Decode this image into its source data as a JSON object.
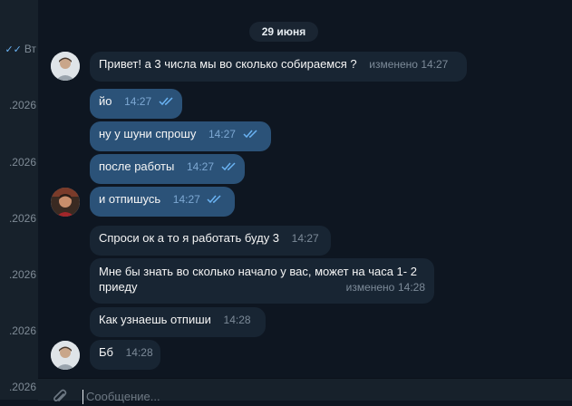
{
  "sidebar": {
    "rows": [
      {
        "day": "Вт",
        "ticks": true
      },
      {
        "date": ".2026"
      },
      {
        "date": ".2026"
      },
      {
        "date": ".2026"
      },
      {
        "date": ".2026"
      },
      {
        "date": ".2026"
      },
      {
        "date": ".2026"
      }
    ]
  },
  "chat": {
    "date_separator": "29 июня",
    "messages": [
      {
        "dir": "in",
        "text": "Привет! а 3 числа мы во сколько собираемся ?",
        "edited": "изменено",
        "time": "14:27"
      },
      {
        "dir": "out",
        "text": "йо",
        "time": "14:27",
        "read": true
      },
      {
        "dir": "out",
        "text": "ну у шуни спрошу",
        "time": "14:27",
        "read": true
      },
      {
        "dir": "out",
        "text": "после работы",
        "time": "14:27",
        "read": true
      },
      {
        "dir": "out",
        "text": "и отпишусь",
        "time": "14:27",
        "read": true
      },
      {
        "dir": "in",
        "text": "Спроси ок а то я работать буду 3",
        "time": "14:27"
      },
      {
        "dir": "in",
        "text": "Мне бы знать во сколько начало у вас, может на часа 1- 2 приеду",
        "edited": "изменено",
        "time": "14:28"
      },
      {
        "dir": "in",
        "text": "Как узнаешь отпиши",
        "time": "14:28"
      },
      {
        "dir": "in",
        "text": "Бб",
        "time": "14:28"
      }
    ]
  },
  "composer": {
    "placeholder": "Сообщение..."
  },
  "colors": {
    "background": "#0e1621",
    "incoming_bubble": "#182533",
    "outgoing_bubble": "#2b5278",
    "read_ticks": "#6ab3f3"
  },
  "icons": {
    "attach": "paperclip-icon",
    "read_receipt": "double-check-icon"
  }
}
